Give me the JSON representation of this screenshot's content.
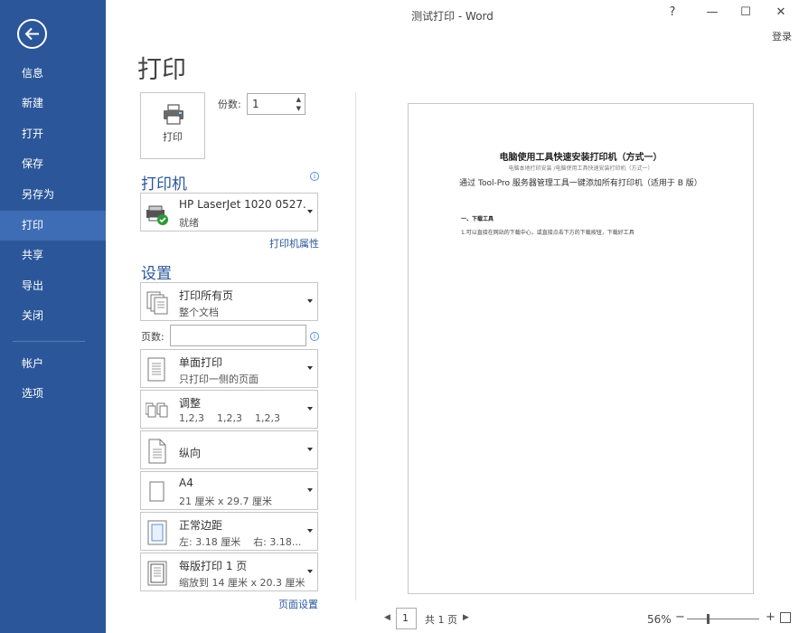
{
  "window": {
    "title": "测试打印 - Word",
    "controls": {
      "help": "?",
      "minimize": "—",
      "maximize": "☐",
      "close": "✕"
    },
    "login": "登录"
  },
  "nav": {
    "items": [
      {
        "label": "信息"
      },
      {
        "label": "新建"
      },
      {
        "label": "打开"
      },
      {
        "label": "保存"
      },
      {
        "label": "另存为"
      },
      {
        "label": "打印",
        "active": true
      },
      {
        "label": "共享"
      },
      {
        "label": "导出"
      },
      {
        "label": "关闭"
      },
      {
        "label": "帐户"
      },
      {
        "label": "选项"
      }
    ]
  },
  "print": {
    "heading": "打印",
    "button_label": "打印",
    "copies_label": "份数:",
    "copies_value": "1"
  },
  "printer": {
    "heading": "打印机",
    "name": "HP LaserJet 1020 0527...",
    "status": "就绪",
    "properties_link": "打印机属性"
  },
  "settings": {
    "heading": "设置",
    "print_range": {
      "line1": "打印所有页",
      "line2": "整个文档"
    },
    "pages_label": "页数:",
    "pages_value": "",
    "sides": {
      "line1": "单面打印",
      "line2": "只打印一侧的页面"
    },
    "collate": {
      "line1": "调整",
      "line2": "1,2,3    1,2,3    1,2,3"
    },
    "orientation": {
      "line1": "纵向"
    },
    "paper": {
      "line1": "A4",
      "line2": "21 厘米 x 29.7 厘米"
    },
    "margins": {
      "line1": "正常边距",
      "line2": "左: 3.18 厘米    右: 3.18..."
    },
    "pages_per_sheet": {
      "line1": "每版打印 1 页",
      "line2": "缩放到 14 厘米 x 20.3 厘米"
    },
    "page_setup_link": "页面设置"
  },
  "preview": {
    "title": "电脑使用工具快速安装打印机（方式一）",
    "subtitle": "电脑本地打印安装 /电脑使用工具快速安装打印机（方式一）",
    "line": "通过 Tool-Pro 服务器管理工具一键添加所有打印机（适用于 B 版）",
    "heading": "一、下载工具",
    "para": "1.可以直接在网站的下载中心，或直接点击下方的下载按钮，下载好工具"
  },
  "statusbar": {
    "current_page": "1",
    "total_pages": "共 1 页",
    "zoom": "56%",
    "zoom_minus": "−",
    "zoom_plus": "+",
    "prev": "◀",
    "next": "▶"
  },
  "colors": {
    "accent": "#2b579a",
    "nav_active": "#3e6db5"
  }
}
